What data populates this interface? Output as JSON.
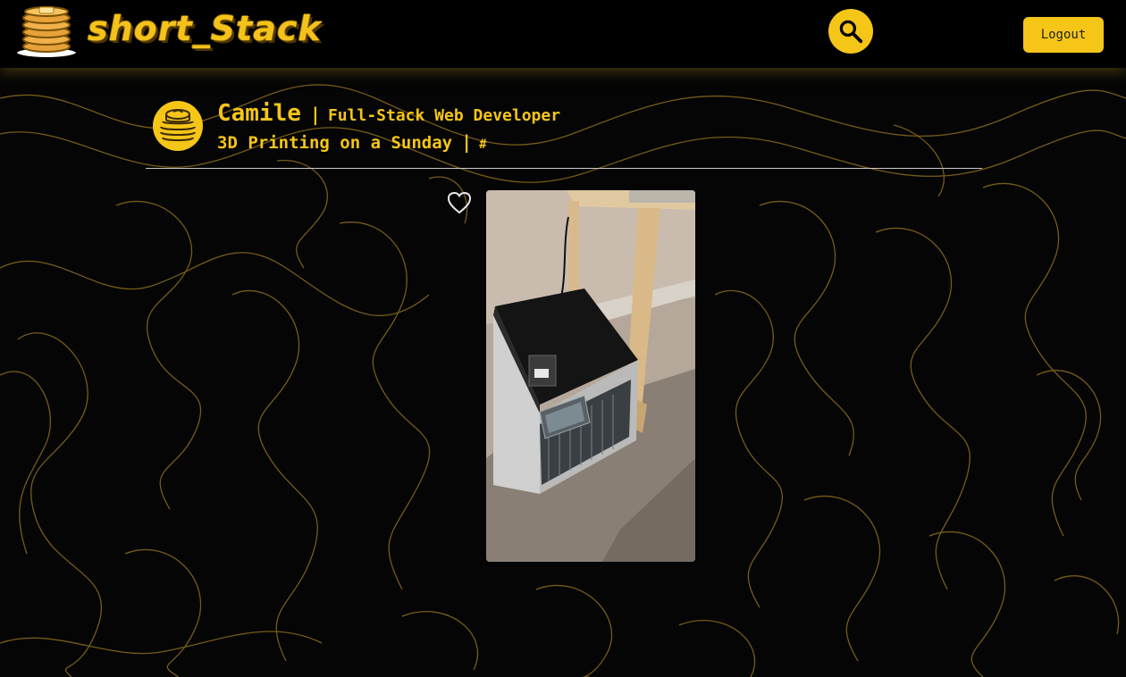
{
  "app": {
    "brand": "short_Stack"
  },
  "header": {
    "search_icon": "search-icon",
    "logout_label": "Logout"
  },
  "post": {
    "author_name": "Camile",
    "separator": "|",
    "author_role": "Full-Stack Web Developer",
    "title": "3D Printing on a Sunday",
    "tag_link": "#",
    "like_icon": "heart-outline-icon",
    "image_subject": "3d-printer-photo"
  },
  "colors": {
    "accent": "#f5c518",
    "background": "#050505",
    "topo_lines": "#8a6a1c",
    "divider": "#c9c9c9"
  }
}
